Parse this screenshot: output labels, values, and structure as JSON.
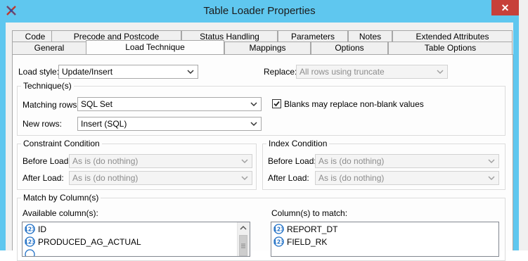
{
  "window": {
    "title": "Table Loader Properties",
    "close_glyph": "✕"
  },
  "tabs_row1": [
    "Code",
    "Precode and Postcode",
    "Status Handling",
    "Parameters",
    "Notes",
    "Extended Attributes"
  ],
  "tabs_row2": [
    "General",
    "Load Technique",
    "Mappings",
    "Options",
    "Table Options"
  ],
  "active_tab": "Load Technique",
  "load": {
    "load_style_label": "Load style:",
    "load_style_value": "Update/Insert",
    "replace_label": "Replace:",
    "replace_value": "All rows using truncate"
  },
  "technique": {
    "title": "Technique(s)",
    "matching_rows_label": "Matching rows:",
    "matching_rows_value": "SQL Set",
    "new_rows_label": "New rows:",
    "new_rows_value": "Insert (SQL)",
    "blanks_label": "Blanks may replace non-blank values",
    "blanks_checked": true
  },
  "constraint": {
    "title": "Constraint Condition",
    "before_label": "Before Load:",
    "before_value": "As is (do nothing)",
    "after_label": "After Load:",
    "after_value": "As is (do nothing)"
  },
  "index": {
    "title": "Index Condition",
    "before_label": "Before Load:",
    "before_value": "As is (do nothing)",
    "after_label": "After Load:",
    "after_value": "As is (do nothing)"
  },
  "match_by_column": {
    "title": "Match by Column(s)",
    "available_label": "Available column(s):",
    "available": [
      "ID",
      "PRODUCED_AG_ACTUAL",
      ""
    ],
    "to_match_label": "Column(s) to match:",
    "to_match": [
      "REPORT_DT",
      "FIELD_RK"
    ]
  },
  "icons": {
    "app": "table-loader-icon",
    "column": "numeric-column-icon",
    "dropdown": "chevron-down-icon"
  },
  "colors": {
    "titlebar": "#5fc7ef",
    "close": "#c7403a",
    "panel": "#fdfdfd",
    "icon_blue": "#1f6fc5"
  }
}
